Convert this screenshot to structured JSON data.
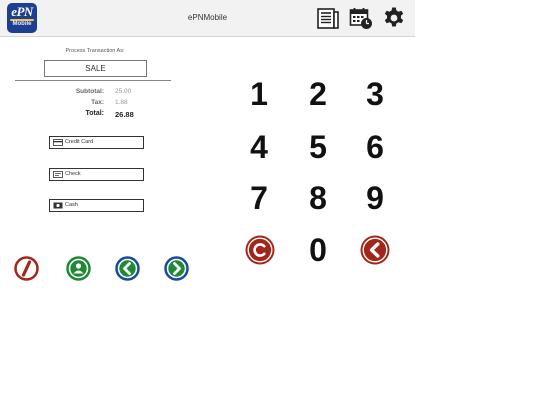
{
  "header": {
    "logo_text": "ePN",
    "logo_subtext": "Mobile",
    "title": "ePNMobile",
    "icons": [
      "receipt-icon",
      "calendar-clock-icon",
      "gear-icon"
    ]
  },
  "transaction": {
    "prompt": "Process Transaction As:",
    "mode": "SALE",
    "subtotal_label": "Subtotal:",
    "subtotal_value": "25.00",
    "tax_label": "Tax:",
    "tax_value": "1.88",
    "total_label": "Total:",
    "total_value": "26.88"
  },
  "payment_methods": [
    {
      "label": "Credit Card",
      "icon": "credit-card-icon"
    },
    {
      "label": "Check",
      "icon": "check-icon"
    },
    {
      "label": "Cash",
      "icon": "cash-icon"
    }
  ],
  "actions": [
    {
      "name": "void",
      "icon": "void-icon",
      "color": "#a3261b"
    },
    {
      "name": "customer",
      "icon": "user-icon",
      "color": "#1e8a34"
    },
    {
      "name": "previous",
      "icon": "chevron-left-icon",
      "color": "#1a4b9c"
    },
    {
      "name": "next",
      "icon": "chevron-right-icon",
      "color": "#1a4b9c"
    }
  ],
  "keypad": {
    "digits": [
      "1",
      "2",
      "3",
      "4",
      "5",
      "6",
      "7",
      "8",
      "9",
      "0"
    ],
    "clear_icon": "copyright-clear-icon",
    "backspace_icon": "circle-chevron-left-icon",
    "accent_color": "#a3261b"
  },
  "colors": {
    "header_bg": "#f2f2f2",
    "logo_bg": "#1c3f93",
    "red": "#a3261b",
    "green": "#1e8a34",
    "blue": "#1a4b9c"
  }
}
